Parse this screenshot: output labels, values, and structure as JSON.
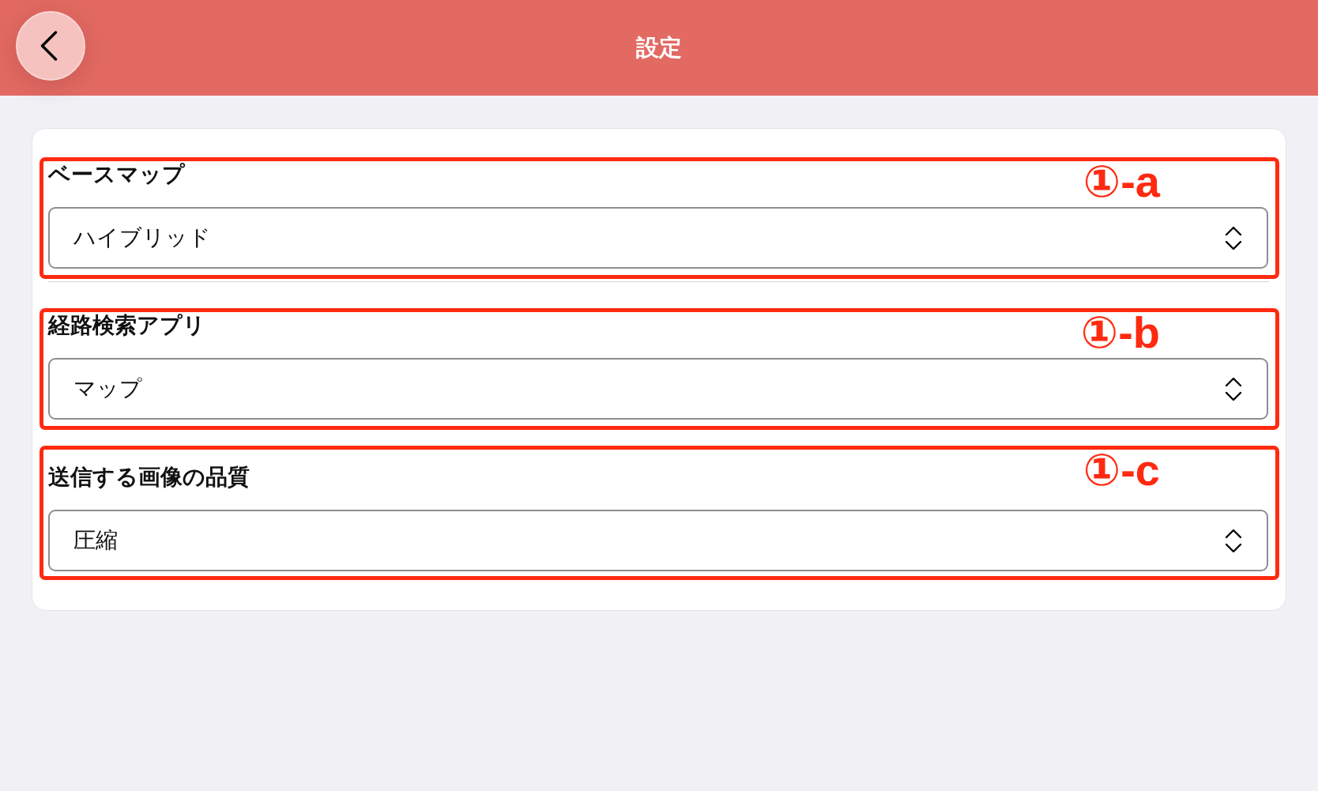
{
  "header": {
    "title": "設定"
  },
  "settings": [
    {
      "label": "ベースマップ",
      "value": "ハイブリッド",
      "annotation": "①-a",
      "separator": true
    },
    {
      "label": "経路検索アプリ",
      "value": "マップ",
      "annotation": "①-b",
      "separator": false
    },
    {
      "label": "送信する画像の品質",
      "value": "圧縮",
      "annotation": "①-c",
      "separator": false
    }
  ]
}
